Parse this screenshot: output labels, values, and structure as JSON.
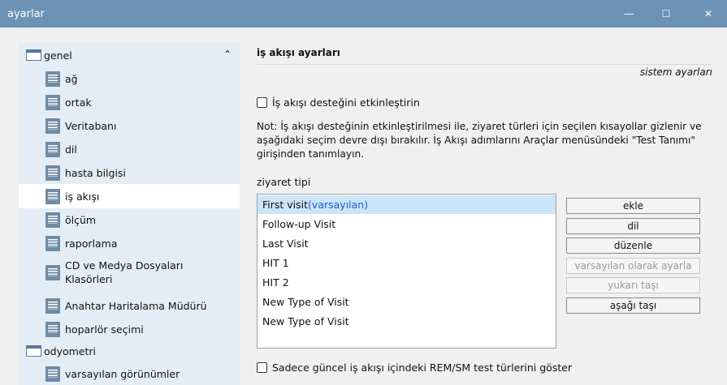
{
  "window": {
    "title": "ayarlar",
    "minimize": "—",
    "maximize": "☐",
    "close": "✕"
  },
  "sidebar": {
    "scroll_up": "⌃",
    "items": [
      {
        "label": "genel",
        "type": "folder",
        "level": 0
      },
      {
        "label": "ağ",
        "type": "page",
        "level": 1
      },
      {
        "label": "ortak",
        "type": "page",
        "level": 1
      },
      {
        "label": "Veritabanı",
        "type": "page",
        "level": 1
      },
      {
        "label": "dil",
        "type": "page",
        "level": 1
      },
      {
        "label": "hasta bilgisi",
        "type": "page",
        "level": 1
      },
      {
        "label": "iş akışı",
        "type": "page",
        "level": 1,
        "selected": true
      },
      {
        "label": "ölçüm",
        "type": "page",
        "level": 1
      },
      {
        "label": "raporlama",
        "type": "page",
        "level": 1
      },
      {
        "label": "CD ve Medya Dosyaları",
        "label2": "Klasörleri",
        "type": "page",
        "level": 1
      },
      {
        "label": "Anahtar Haritalama Müdürü",
        "type": "page",
        "level": 1
      },
      {
        "label": "hoparlör seçimi",
        "type": "page",
        "level": 1
      },
      {
        "label": "odyometri",
        "type": "folder",
        "level": 0
      },
      {
        "label": "varsayılan görünümler",
        "type": "page",
        "level": 1
      }
    ]
  },
  "main": {
    "section_title": "iş akışı ayarları",
    "system_settings_link": "sistem ayarları",
    "enable_workflow_label": "İş akışı desteğini etkinleştirin",
    "note_line1": "Not: İş akışı desteğinin etkinleştirilmesi ile, ziyaret türleri için seçilen kısayollar gizlenir ve",
    "note_line2": "aşağıdaki seçim devre dışı bırakılır. İş Akışı adımlarını Araçlar menüsündeki \"Test Tanımı\"",
    "note_line3": "girişinden tanımlayın.",
    "visit_type_label": "ziyaret tipi",
    "visit_types": [
      {
        "label": "First visit",
        "default_tag": "(varsayılan)",
        "selected": true
      },
      {
        "label": "Follow-up Visit"
      },
      {
        "label": "Last Visit"
      },
      {
        "label": "HIT 1"
      },
      {
        "label": "HIT 2"
      },
      {
        "label": "New Type of Visit"
      },
      {
        "label": "New Type of Visit"
      }
    ],
    "buttons": {
      "add": "ekle",
      "language": "dil",
      "edit": "düzenle",
      "set_default": "varsayılan olarak ayarla",
      "move_up": "yukarı taşı",
      "move_down": "aşağı taşı"
    },
    "rem_sm_label": "Sadece güncel iş akışı içindeki REM/SM test türlerini göster"
  }
}
